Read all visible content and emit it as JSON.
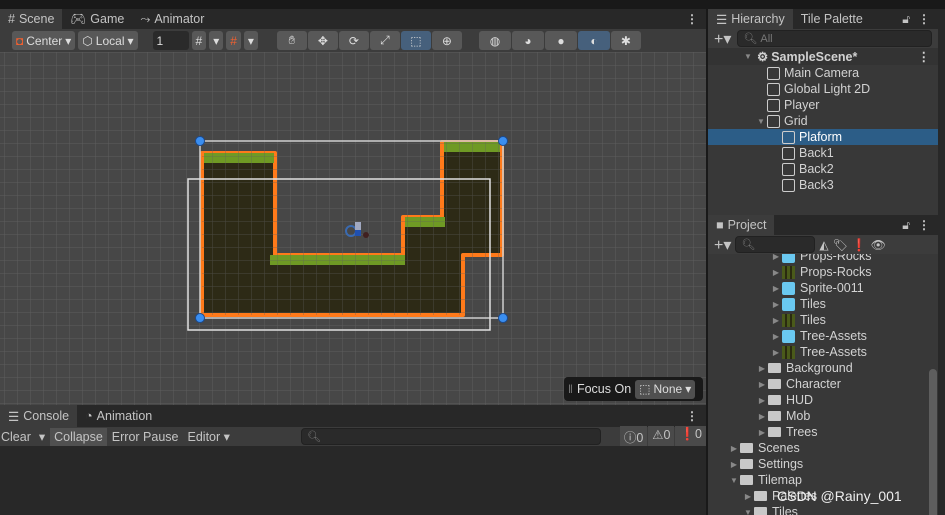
{
  "scene_tabs": [
    {
      "label": "Scene",
      "icon": "grid-icon"
    },
    {
      "label": "Game",
      "icon": "gamepad-icon"
    },
    {
      "label": "Animator",
      "icon": "animator-icon"
    }
  ],
  "scene_toolbar": {
    "pivot": "Center",
    "space": "Local",
    "grid_size": "1",
    "tools": [
      "hand-icon",
      "move-icon",
      "rotate-icon",
      "scale-icon",
      "rect-tool-icon",
      "transform-icon"
    ],
    "active_tool": "rect-tool-icon"
  },
  "overlay": {
    "focus_label": "Focus On",
    "focus_value": "None"
  },
  "console": {
    "tabs": [
      {
        "label": "Console"
      },
      {
        "label": "Animation"
      }
    ],
    "clear": "Clear",
    "collapse": "Collapse",
    "error_pause": "Error Pause",
    "editor": "Editor",
    "log_count": "0",
    "warn_count": "0",
    "error_count": "0"
  },
  "hierarchy": {
    "tabs": [
      {
        "label": "Hierarchy"
      },
      {
        "label": "Tile Palette"
      }
    ],
    "search_placeholder": "All",
    "scene": "SampleScene*",
    "items": [
      {
        "label": "Main Camera"
      },
      {
        "label": "Global Light 2D"
      },
      {
        "label": "Player"
      },
      {
        "label": "Grid"
      },
      {
        "label": "Plaform",
        "selected": true
      },
      {
        "label": "Back1"
      },
      {
        "label": "Back2"
      },
      {
        "label": "Back3"
      }
    ]
  },
  "project": {
    "tab": "Project",
    "items": [
      {
        "label": "Props-Rocks",
        "type": "asset"
      },
      {
        "label": "Props-Rocks",
        "type": "sheet"
      },
      {
        "label": "Sprite-0011",
        "type": "asset"
      },
      {
        "label": "Tiles",
        "type": "asset"
      },
      {
        "label": "Tiles",
        "type": "sheet"
      },
      {
        "label": "Tree-Assets",
        "type": "asset"
      },
      {
        "label": "Tree-Assets",
        "type": "sheet"
      },
      {
        "label": "Background",
        "type": "folder"
      },
      {
        "label": "Character",
        "type": "folder"
      },
      {
        "label": "HUD",
        "type": "folder"
      },
      {
        "label": "Mob",
        "type": "folder"
      },
      {
        "label": "Trees",
        "type": "folder"
      },
      {
        "label": "Scenes",
        "type": "folder"
      },
      {
        "label": "Settings",
        "type": "folder"
      },
      {
        "label": "Tilemap",
        "type": "folder"
      },
      {
        "label": "Palettes",
        "type": "folder"
      },
      {
        "label": "Tiles",
        "type": "folder"
      }
    ]
  },
  "watermark": "CSDN @Rainy_001",
  "colors": {
    "selection": "#2c5d87",
    "outline": "#ff7a1a",
    "handle": "#3a8ef0"
  }
}
